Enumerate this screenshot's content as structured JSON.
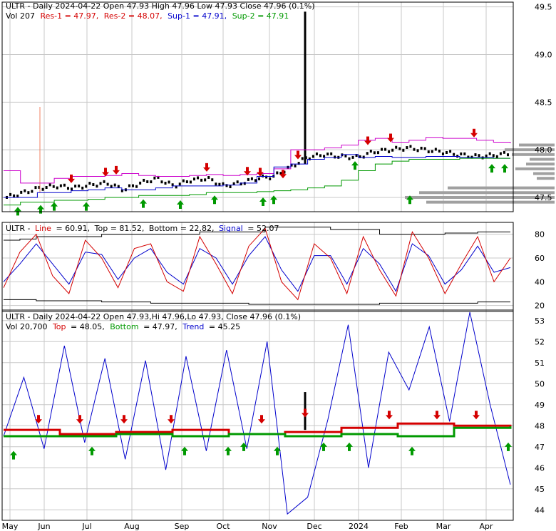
{
  "colors": {
    "red": "#d40000",
    "green": "#009900",
    "blue": "#0000cc",
    "magenta": "#cc00cc",
    "gray": "#a0a0a0",
    "grid": "#c8c8c8",
    "black": "#000000"
  },
  "panel1": {
    "title": "ULTR - Daily 2024-04-22 Open 47.93  High 47.96  Low 47.93  Close 47.96 (0.1%)",
    "vol_label": "Vol 207",
    "res1_label": "Res-1 = 47.97,",
    "res2_label": "Res-2 = 48.07,",
    "sup1_label": "Sup-1 = 47.91,",
    "sup2_label": "Sup-2 = 47.91",
    "y_ticks": [
      "49.5",
      "49.0",
      "48.5",
      "48.0",
      "47.5"
    ]
  },
  "panel2": {
    "name": "ULTR -",
    "line_label": "Line",
    "line_value": "= 60.91,",
    "top_label": "Top = 81.52,",
    "bottom_label": "Bottom = 22.82,",
    "signal_label": "Signal",
    "signal_value": "= 52.07",
    "y_ticks": [
      "80",
      "60",
      "40",
      "20"
    ]
  },
  "panel3": {
    "title": "ULTR - Daily 2024-04-22 Open 47.93,Hi 47.96,Lo 47.93, Close 47.96 (0.1%)",
    "vol_label": "Vol 20,700",
    "top_label": "Top",
    "top_value": "= 48.05,",
    "bottom_label": "Bottom",
    "bottom_value": "= 47.97,",
    "trend_label": "Trend",
    "trend_value": "= 45.25",
    "y_ticks": [
      "53",
      "52",
      "51",
      "50",
      "49",
      "48",
      "47",
      "46",
      "45",
      "44"
    ]
  },
  "x_labels": [
    "May",
    "Jun",
    "Jul",
    "Aug",
    "Sep",
    "Oct",
    "Nov",
    "Dec",
    "2024",
    "Feb",
    "Mar",
    "Apr"
  ],
  "chart_data": [
    {
      "type": "line",
      "title": "ULTR - Daily 2024-04-22 Open 47.93  High 47.96  Low 47.93  Close 47.96 (0.1%)",
      "x_labels": [
        "May",
        "Jun",
        "Jul",
        "Aug",
        "Sep",
        "Oct",
        "Nov",
        "Dec",
        "2024",
        "Feb",
        "Mar",
        "Apr"
      ],
      "ylim": [
        47.35,
        49.55
      ],
      "series": [
        {
          "name": "Close",
          "values": [
            47.5,
            47.55,
            47.6,
            47.62,
            47.6,
            47.63,
            47.65,
            47.58,
            47.65,
            47.7,
            47.62,
            47.68,
            47.7,
            47.62,
            47.65,
            47.7,
            47.72,
            47.82,
            47.92,
            47.95,
            47.93,
            47.92,
            47.98,
            48.0,
            48.02,
            48.0,
            47.98,
            47.95,
            47.93,
            47.94,
            47.96
          ]
        },
        {
          "name": "Res-1",
          "values": [
            47.78,
            47.65,
            47.65,
            47.7,
            47.72,
            47.72,
            47.73,
            47.75,
            47.73,
            47.72,
            47.72,
            47.73,
            47.74,
            47.73,
            47.74,
            47.75,
            47.8,
            48.0,
            48.0,
            48.02,
            48.05,
            48.1,
            48.12,
            48.08,
            48.1,
            48.13,
            48.12,
            48.12,
            48.1,
            48.08,
            48.07
          ]
        },
        {
          "name": "Sup-1",
          "values": [
            47.5,
            47.5,
            47.55,
            47.55,
            47.57,
            47.58,
            47.6,
            47.58,
            47.58,
            47.6,
            47.62,
            47.62,
            47.62,
            47.63,
            47.65,
            47.72,
            47.82,
            47.85,
            47.9,
            47.92,
            47.95,
            47.92,
            47.93,
            47.92,
            47.92,
            47.93,
            47.93,
            47.92,
            47.92,
            47.91,
            47.91
          ]
        },
        {
          "name": "Sup-2",
          "values": [
            47.42,
            47.45,
            47.45,
            47.47,
            47.47,
            47.48,
            47.5,
            47.5,
            47.52,
            47.52,
            47.52,
            47.53,
            47.55,
            47.55,
            47.55,
            47.56,
            47.57,
            47.58,
            47.6,
            47.62,
            47.68,
            47.78,
            47.85,
            47.88,
            47.9,
            47.9,
            47.9,
            47.91,
            47.91,
            47.91,
            47.91
          ]
        }
      ]
    },
    {
      "type": "line",
      "title": "ULTR - Line = 60.91, Top = 81.52, Bottom = 22.82, Signal = 52.07",
      "ylim": [
        15,
        90
      ],
      "series": [
        {
          "name": "Line",
          "values": [
            35,
            65,
            80,
            45,
            30,
            75,
            60,
            35,
            68,
            72,
            40,
            32,
            78,
            55,
            30,
            70,
            85,
            40,
            25,
            72,
            60,
            30,
            78,
            50,
            28,
            82,
            60,
            30,
            55,
            78,
            40,
            60
          ]
        },
        {
          "name": "Signal",
          "values": [
            40,
            55,
            72,
            55,
            38,
            65,
            63,
            42,
            60,
            68,
            48,
            38,
            68,
            60,
            38,
            62,
            78,
            50,
            32,
            62,
            62,
            38,
            68,
            55,
            32,
            72,
            62,
            38,
            50,
            70,
            48,
            52
          ]
        },
        {
          "name": "Top",
          "values": [
            75,
            76,
            78,
            78,
            78,
            78,
            80,
            80,
            80,
            80,
            80,
            80,
            82,
            82,
            82,
            82,
            86,
            86,
            86,
            86,
            84,
            84,
            84,
            80,
            80,
            80,
            80,
            81,
            81,
            82,
            82,
            82
          ]
        },
        {
          "name": "Bottom",
          "values": [
            25,
            25,
            24,
            24,
            24,
            24,
            23,
            23,
            23,
            22,
            22,
            22,
            22,
            22,
            22,
            21,
            21,
            21,
            21,
            21,
            21,
            21,
            21,
            22,
            22,
            22,
            22,
            22,
            22,
            23,
            23,
            23
          ]
        }
      ]
    },
    {
      "type": "line",
      "title": "ULTR - Daily 2024-04-22 Open 47.93,Hi 47.96,Lo 47.93, Close 47.96 (0.1%)",
      "ylim": [
        43.5,
        53.5
      ],
      "series": [
        {
          "name": "Trend",
          "values": [
            47.5,
            50.3,
            46.9,
            51.8,
            47.2,
            51.2,
            46.4,
            51.1,
            45.9,
            51.3,
            46.8,
            51.6,
            46.9,
            52.0,
            43.8,
            44.6,
            48.3,
            52.8,
            46.0,
            51.5,
            49.7,
            52.7,
            48.2,
            53.4,
            49.0,
            45.2
          ]
        },
        {
          "name": "Top",
          "values": [
            47.8,
            47.6,
            47.7,
            47.8,
            47.6,
            47.7,
            47.9,
            48.1,
            48.0,
            48.05
          ]
        },
        {
          "name": "Bottom",
          "values": [
            47.5,
            47.5,
            47.6,
            47.5,
            47.6,
            47.5,
            47.6,
            47.5,
            47.9,
            47.97
          ]
        }
      ]
    }
  ]
}
